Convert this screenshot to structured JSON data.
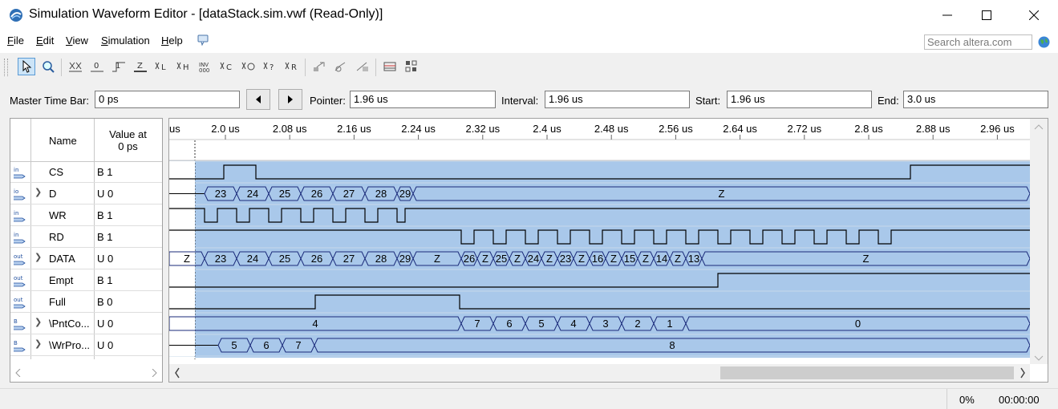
{
  "window": {
    "title": "Simulation Waveform Editor - [dataStack.sim.vwf (Read-Only)]"
  },
  "menu": [
    {
      "label": "File",
      "u": "F",
      "rest": "ile"
    },
    {
      "label": "Edit",
      "u": "E",
      "rest": "dit"
    },
    {
      "label": "View",
      "u": "V",
      "rest": "iew"
    },
    {
      "label": "Simulation",
      "u": "S",
      "rest": "imulation"
    },
    {
      "label": "Help",
      "u": "H",
      "rest": "elp"
    }
  ],
  "search": {
    "placeholder": "Search altera.com"
  },
  "toolbar": {
    "icons": [
      "selection-tool-icon",
      "zoom-tool-icon",
      "forcing-unknown-icon",
      "forcing-low-icon",
      "forcing-high-icon",
      "high-impedance-icon",
      "weak-low-icon",
      "weak-high-icon",
      "invert-icon",
      "count-value-icon",
      "clock-value-icon",
      "random-value-icon",
      "arbitrary-value-icon",
      "run-functional-simulation-icon",
      "run-timing-simulation-icon",
      "generate-netlist-icon",
      "open-report-icon",
      "compare-icon"
    ]
  },
  "timebar": {
    "master_label": "Master Time Bar:",
    "master_value": "0 ps",
    "pointer_label": "Pointer:",
    "pointer_value": "1.96 us",
    "interval_label": "Interval:",
    "interval_value": "1.96 us",
    "start_label": "Start:",
    "start_value": "1.96 us",
    "end_label": "End:",
    "end_value": "3.0 us"
  },
  "signals_header": {
    "name": "Name",
    "value_line1": "Value at",
    "value_line2": "0 ps"
  },
  "signals": [
    {
      "type": "in",
      "name": "CS",
      "value": "B 1",
      "expand": false
    },
    {
      "type": "io",
      "name": "D",
      "value": "U 0",
      "expand": true
    },
    {
      "type": "in",
      "name": "WR",
      "value": "B 1",
      "expand": false
    },
    {
      "type": "in",
      "name": "RD",
      "value": "B 1",
      "expand": false
    },
    {
      "type": "out",
      "name": "DATA",
      "value": "U 0",
      "expand": true
    },
    {
      "type": "out",
      "name": "Empt",
      "value": "B 1",
      "expand": false
    },
    {
      "type": "out",
      "name": "Full",
      "value": "B 0",
      "expand": false
    },
    {
      "type": "bur",
      "name": "\\PntCo...",
      "value": "U 0",
      "expand": true
    },
    {
      "type": "bur",
      "name": "\\WrPro...",
      "value": "U 0",
      "expand": true
    }
  ],
  "timeline": {
    "first_label": "us",
    "ticks": [
      "2.0 us",
      "2.08 us",
      "2.16 us",
      "2.24 us",
      "2.32 us",
      "2.4 us",
      "2.48 us",
      "2.56 us",
      "2.64 us",
      "2.72 us",
      "2.8 us",
      "2.88 us",
      "2.96 us"
    ]
  },
  "waves": {
    "CS": [
      [
        1,
        232
      ],
      [
        0,
        1076
      ],
      [
        1,
        1116
      ],
      [
        0,
        1932
      ],
      [
        1,
        99999
      ]
    ],
    "WR": [
      [
        1,
        1052
      ],
      [
        0,
        1068
      ],
      [
        1,
        1092
      ],
      [
        0,
        1108
      ],
      [
        1,
        1132
      ],
      [
        0,
        1148
      ],
      [
        1,
        1172
      ],
      [
        0,
        1188
      ],
      [
        1,
        1212
      ],
      [
        0,
        1228
      ],
      [
        1,
        1252
      ],
      [
        0,
        1268
      ],
      [
        1,
        1292
      ],
      [
        0,
        1302
      ],
      [
        1,
        99999
      ]
    ],
    "RD": [
      [
        1,
        1372
      ],
      [
        0,
        1388
      ],
      [
        1,
        1412
      ],
      [
        0,
        1428
      ],
      [
        1,
        1452
      ],
      [
        0,
        1468
      ],
      [
        1,
        1492
      ],
      [
        0,
        1508
      ],
      [
        1,
        1532
      ],
      [
        0,
        1548
      ],
      [
        1,
        1572
      ],
      [
        0,
        1588
      ],
      [
        1,
        1612
      ],
      [
        0,
        1628
      ],
      [
        1,
        1652
      ],
      [
        0,
        1668
      ],
      [
        1,
        1692
      ],
      [
        0,
        1708
      ],
      [
        1,
        1732
      ],
      [
        0,
        1748
      ],
      [
        1,
        1772
      ],
      [
        0,
        1788
      ],
      [
        1,
        1812
      ],
      [
        0,
        1828
      ],
      [
        1,
        1852
      ],
      [
        0,
        1868
      ],
      [
        1,
        1892
      ],
      [
        0,
        1908
      ],
      [
        1,
        99999
      ]
    ],
    "Empt": [
      [
        0,
        1692
      ],
      [
        1,
        99999
      ]
    ],
    "Full": [
      [
        0,
        1190
      ],
      [
        1,
        1370
      ],
      [
        0,
        99999
      ]
    ],
    "D": [
      [
        "",
        1052
      ],
      [
        "23",
        1092
      ],
      [
        "24",
        1132
      ],
      [
        "25",
        1172
      ],
      [
        "26",
        1212
      ],
      [
        "27",
        1252
      ],
      [
        "28",
        1292
      ],
      [
        "29",
        1312
      ],
      [
        "Z",
        99999
      ]
    ],
    "DATA": [
      [
        "Z",
        1052
      ],
      [
        "23",
        1092
      ],
      [
        "24",
        1132
      ],
      [
        "25",
        1172
      ],
      [
        "26",
        1212
      ],
      [
        "27",
        1252
      ],
      [
        "28",
        1292
      ],
      [
        "29",
        1312
      ],
      [
        "Z",
        1372
      ],
      [
        "26",
        1392
      ],
      [
        "Z",
        1412
      ],
      [
        "25",
        1432
      ],
      [
        "Z",
        1452
      ],
      [
        "24",
        1472
      ],
      [
        "Z",
        1492
      ],
      [
        "23",
        1512
      ],
      [
        "Z",
        1532
      ],
      [
        "16",
        1552
      ],
      [
        "Z",
        1572
      ],
      [
        "15",
        1592
      ],
      [
        "Z",
        1612
      ],
      [
        "14",
        1632
      ],
      [
        "Z",
        1652
      ],
      [
        "13",
        1672
      ],
      [
        "Z",
        99999
      ]
    ],
    "PntCo": [
      [
        "4",
        1372
      ],
      [
        "7",
        1412
      ],
      [
        "6",
        1452
      ],
      [
        "5",
        1492
      ],
      [
        "4",
        1532
      ],
      [
        "3",
        1572
      ],
      [
        "2",
        1612
      ],
      [
        "1",
        1652
      ],
      [
        "0",
        99999
      ]
    ],
    "WrPro": [
      [
        "",
        1069
      ],
      [
        "5",
        1109
      ],
      [
        "6",
        1149
      ],
      [
        "7",
        1189
      ],
      [
        "8",
        99999
      ]
    ]
  },
  "status": {
    "progress": "0%",
    "time": "00:00:00"
  }
}
